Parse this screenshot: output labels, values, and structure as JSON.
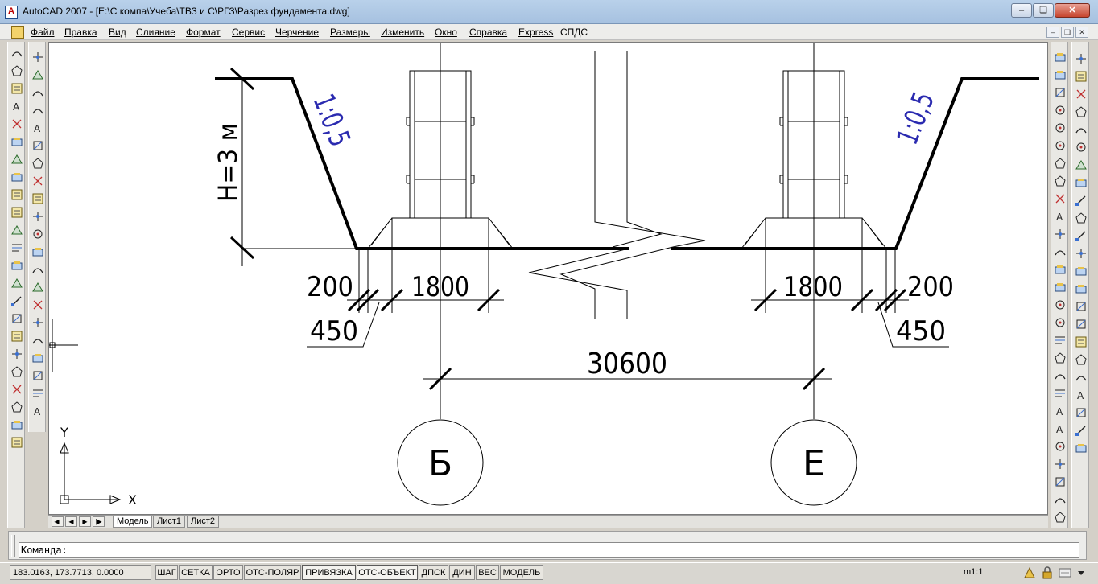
{
  "window": {
    "title": "AutoCAD 2007 - [E:\\С компа\\Учеба\\ТВЗ и С\\РГЗ\\Разрез фундамента.dwg]",
    "controls": [
      "minimize",
      "maximize",
      "close"
    ]
  },
  "menu": {
    "items": [
      "Файл",
      "Правка",
      "Вид",
      "Слияние",
      "Формат",
      "Сервис",
      "Черчение",
      "Размеры",
      "Изменить",
      "Окно",
      "Справка",
      "Express",
      "СПДС"
    ]
  },
  "drawing": {
    "slope_left": "1:0,5",
    "slope_right": "1:0,5",
    "height_label": "H=3 м",
    "dim_200_left": "200",
    "dim_1800_left": "1800",
    "dim_450_left": "450",
    "dim_1800_right": "1800",
    "dim_200_right": "200",
    "dim_450_right": "450",
    "dim_total": "30600",
    "axis_left": "Б",
    "axis_right": "Е",
    "ucs_y": "Y",
    "ucs_x": "X"
  },
  "layout_tabs": [
    "Модель",
    "Лист1",
    "Лист2"
  ],
  "active_layout_tab": "Модель",
  "command": {
    "prompt": "Команда:"
  },
  "status": {
    "coordinates": "183.0163, 173.7713, 0.0000",
    "toggles": [
      "ШАГ",
      "СЕТКА",
      "ОРТО",
      "ОТС-ПОЛЯР",
      "ПРИВЯЗКА",
      "ОТС-ОБЪЕКТ",
      "ДПСК",
      "ДИН",
      "ВЕС",
      "МОДЕЛЬ"
    ],
    "toggles_on": [
      "ПРИВЯЗКА",
      "ОТС-ОБЪЕКТ"
    ],
    "annotation_scale": "m1:1"
  },
  "colors": {
    "slope_text": "#2b2bb0",
    "canvas_bg": "#ffffff",
    "title_bar": "#b9d1ea"
  },
  "toolbars": {
    "left_outer_icons": [
      "linear-dim-icon",
      "aligned-dim-icon",
      "ordinate-dim-icon",
      "radius-dim-icon",
      "angular-dim-icon",
      "baseline-dim-icon",
      "continue-dim-icon",
      "text-style-icon",
      "leader-icon",
      "hatch-icon",
      "gradient-icon",
      "insert-block-icon",
      "table-icon",
      "mtext-icon",
      "field-icon",
      "layer-icon",
      "properties-icon",
      "layer-state-icon",
      "select-icon",
      "distance-icon",
      "area-icon",
      "massprop-icon",
      "list-icon"
    ],
    "left_inner_icons": [
      "line-icon",
      "construction-line-icon",
      "polyline-icon",
      "polygon-icon",
      "rectangle-icon",
      "arc-icon",
      "circle-icon",
      "revcloud-icon",
      "spline-icon",
      "ellipse-icon",
      "ellipse-arc-icon",
      "insert-icon",
      "make-block-icon",
      "point-icon",
      "hatch-pattern-icon",
      "gradient-fill-icon",
      "region-icon",
      "table-insert-icon",
      "multiline-text-icon",
      "xref-icon",
      "image-icon",
      "edit-text-icon",
      "dim-edit-icon",
      "dim-update-icon"
    ],
    "right_inner_icons": [
      "erase-icon",
      "copy-icon",
      "mirror-icon",
      "offset-icon",
      "array-icon",
      "move-icon",
      "rotate-icon",
      "scale-icon",
      "stretch-icon",
      "trim-icon",
      "extend-icon",
      "break-point-icon",
      "break-icon",
      "join-icon",
      "chamfer-icon",
      "fillet-icon",
      "explode-icon",
      "measure-icon",
      "zoom-icon",
      "dist-icon",
      "ratio-icon",
      "link-icon",
      "spline-edit-icon",
      "align-icon",
      "lengthen-icon",
      "text-edit-icon",
      "mtext-edit-icon",
      "attribute-icon"
    ],
    "right_outer_icons": [
      "properties-panel-icon",
      "design-center-icon",
      "tool-palettes-icon",
      "sheet-set-icon",
      "markup-icon",
      "calc-icon",
      "block-editor-icon",
      "block-attr-icon",
      "zoom-window-icon",
      "pan-icon",
      "scale-1-2-icon",
      "arrow-icon",
      "curve-icon",
      "wave-icon",
      "spring-icon",
      "block-icon",
      "dim-symbol-icon",
      "section-icon",
      "node-icon",
      "text-a-icon",
      "text-style-a-icon",
      "table-edit-icon",
      "table-x-icon"
    ]
  }
}
